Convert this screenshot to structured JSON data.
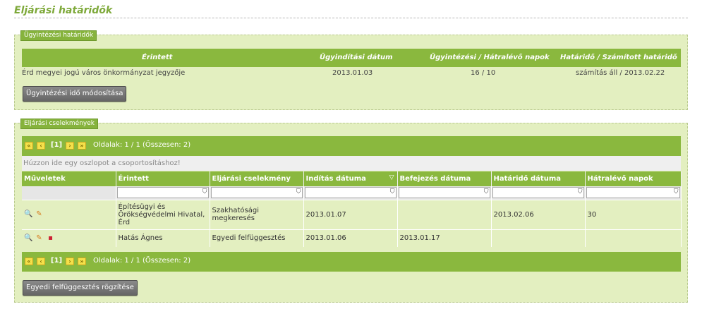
{
  "page_title": "Eljárási határidők",
  "deadlines": {
    "legend": "Ügyintézési határidők",
    "headers": [
      "Érintett",
      "Ügyindítási dátum",
      "Ügyintézési / Hátralévő napok",
      "Határidő / Számított határidő"
    ],
    "row": {
      "affected": "Érd megyei jogú város önkormányzat jegyzője",
      "start_date": "2013.01.03",
      "days": "16 / 10",
      "deadline": "számítás áll / 2013.02.22"
    },
    "modify_button": "Ügyintézési idő módosítása"
  },
  "actions_section": {
    "legend": "Eljárási cselekmények",
    "pager": {
      "first": "«",
      "prev": "‹",
      "current": "[1]",
      "next": "›",
      "last": "»",
      "info": "Oldalak: 1 / 1 (Összesen: 2)"
    },
    "group_hint": "Húzzon ide egy oszlopot a csoportosításhoz!",
    "columns": [
      "Műveletek",
      "Érintett",
      "Eljárási cselekmény",
      "Indítás dátuma",
      "Befejezés dátuma",
      "Határidő dátuma",
      "Hátralévő napok"
    ],
    "rows": [
      {
        "affected": "Építésügyi és Örökségvédelmi Hivatal, Érd",
        "action": "Szakhatósági megkeresés",
        "start": "2013.01.07",
        "end": "",
        "deadline": "2013.02.06",
        "remaining": "30"
      },
      {
        "affected": "Hatás Ágnes",
        "action": "Egyedi felfüggesztés",
        "start": "2013.01.06",
        "end": "2013.01.17",
        "deadline": "",
        "remaining": ""
      }
    ],
    "suspend_button": "Egyedi felfüggesztés rögzítése"
  },
  "icons": {
    "view": "magnifier-icon",
    "edit": "pencil-icon",
    "delete": "delete-icon",
    "filter": "filter-icon",
    "sort": "sort-desc-icon"
  },
  "colors": {
    "accent_green": "#8ab83e",
    "panel_bg": "#e3efc0",
    "pager_button": "#f4e04a",
    "title": "#7ea93a"
  }
}
